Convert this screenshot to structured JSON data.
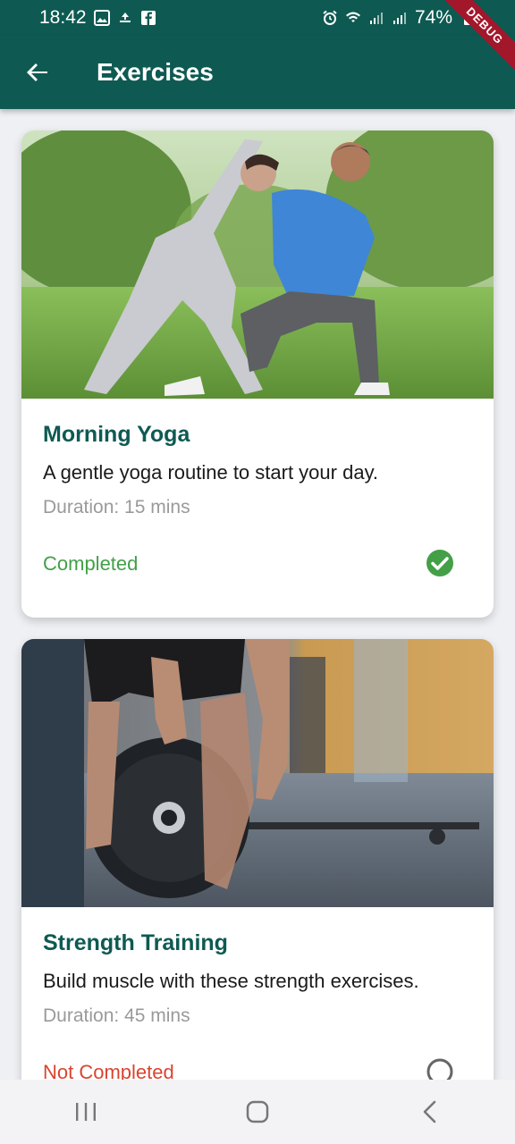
{
  "status_bar": {
    "time": "18:42",
    "battery": "74%",
    "debug": "DEBUG"
  },
  "app_bar": {
    "title": "Exercises"
  },
  "exercises": [
    {
      "title": "Morning Yoga",
      "description": "A gentle yoga routine to start your day.",
      "duration": "Duration: 15 mins",
      "status": "Completed",
      "status_color": "#43a047",
      "completed": true
    },
    {
      "title": "Strength Training",
      "description": "Build muscle with these strength exercises.",
      "duration": "Duration: 45 mins",
      "status": "Not Completed",
      "status_color": "#d9452f",
      "completed": false
    }
  ],
  "colors": {
    "primary": "#0e5a52",
    "background": "#eef0f4"
  }
}
